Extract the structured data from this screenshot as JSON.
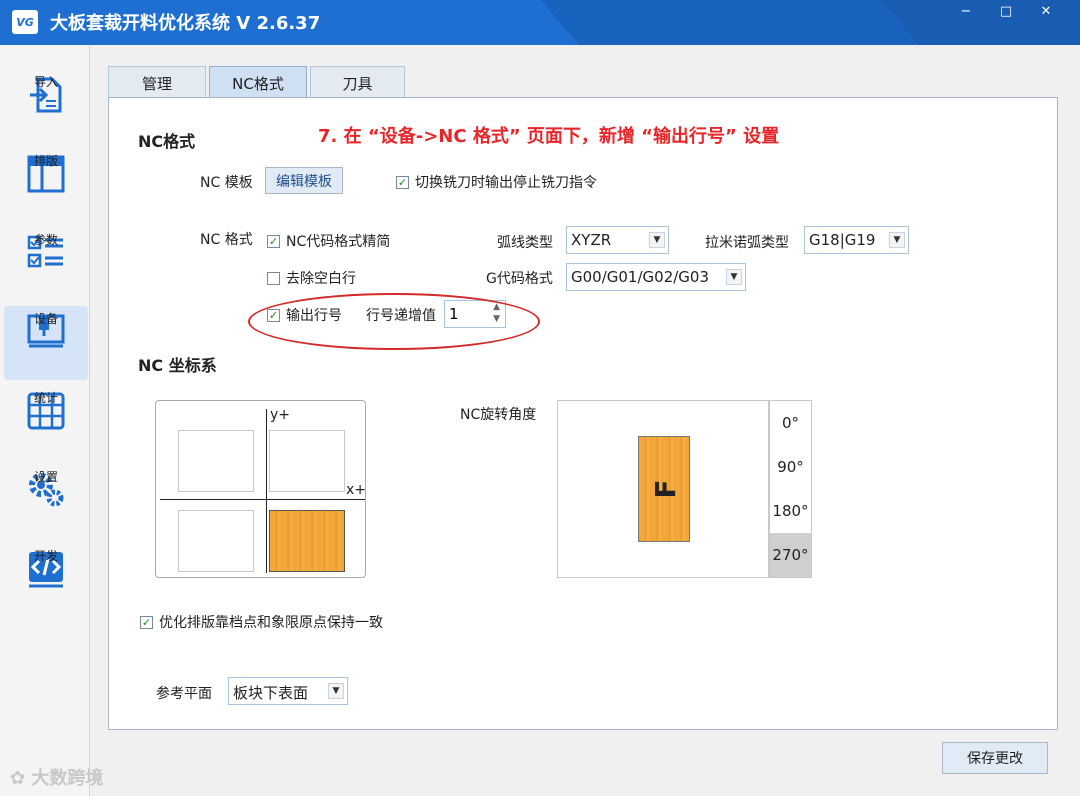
{
  "app": {
    "title": "大板套裁开料优化系统  V 2.6.37",
    "logo_text": "VG"
  },
  "window_controls": {
    "minimize": "−",
    "maximize": "□",
    "close": "✕"
  },
  "sidebar": {
    "items": [
      {
        "label": "导入",
        "icon": "import-icon"
      },
      {
        "label": "排版",
        "icon": "layout-icon"
      },
      {
        "label": "参数",
        "icon": "parameters-icon"
      },
      {
        "label": "设备",
        "icon": "device-icon",
        "active": true
      },
      {
        "label": "统计",
        "icon": "statistics-icon"
      },
      {
        "label": "设置",
        "icon": "settings-gear-icon"
      },
      {
        "label": "开发",
        "icon": "code-icon"
      }
    ]
  },
  "tabs": [
    {
      "label": "管理"
    },
    {
      "label": "NC格式",
      "active": true
    },
    {
      "label": "刀具"
    }
  ],
  "annotation": "7. 在 “设备->NC 格式” 页面下，新增 “输出行号” 设置",
  "nc_format": {
    "section_title": "NC格式",
    "template_label": "NC 模板",
    "edit_template_button": "编辑模板",
    "switch_mill_checkbox": "切换铣刀时输出停止铣刀指令",
    "format_label": "NC 格式",
    "simplify_checkbox": "NC代码格式精简",
    "remove_blank_checkbox": "去除空白行",
    "output_line_no_checkbox": "输出行号",
    "line_increment_label": "行号递增值",
    "line_increment_value": "1",
    "arc_type_label": "弧线类型",
    "arc_type_value": "XYZR",
    "lamino_arc_label": "拉米诺弧类型",
    "lamino_arc_value": "G18|G19",
    "gcode_format_label": "G代码格式",
    "gcode_format_value": "G00/G01/G02/G03"
  },
  "nc_coord": {
    "section_title": "NC 坐标系",
    "y_axis_label": "y+",
    "x_axis_label": "x+",
    "rotation_label": "NC旋转角度",
    "rotation_letter": "F",
    "rotations": [
      "0°",
      "90°",
      "180°",
      "270°"
    ],
    "selected_rotation": "270°"
  },
  "keep_consistent_checkbox": "优化排版靠档点和象限原点保持一致",
  "ref_plane_label": "参考平面",
  "ref_plane_value": "板块下表面",
  "save_button": "保存更改",
  "watermark": "大数跨境",
  "colors": {
    "title_bar": "#1e6fd1",
    "annotation": "#e8262a",
    "check": "#1e8a2e",
    "wood": "#f3a738"
  }
}
